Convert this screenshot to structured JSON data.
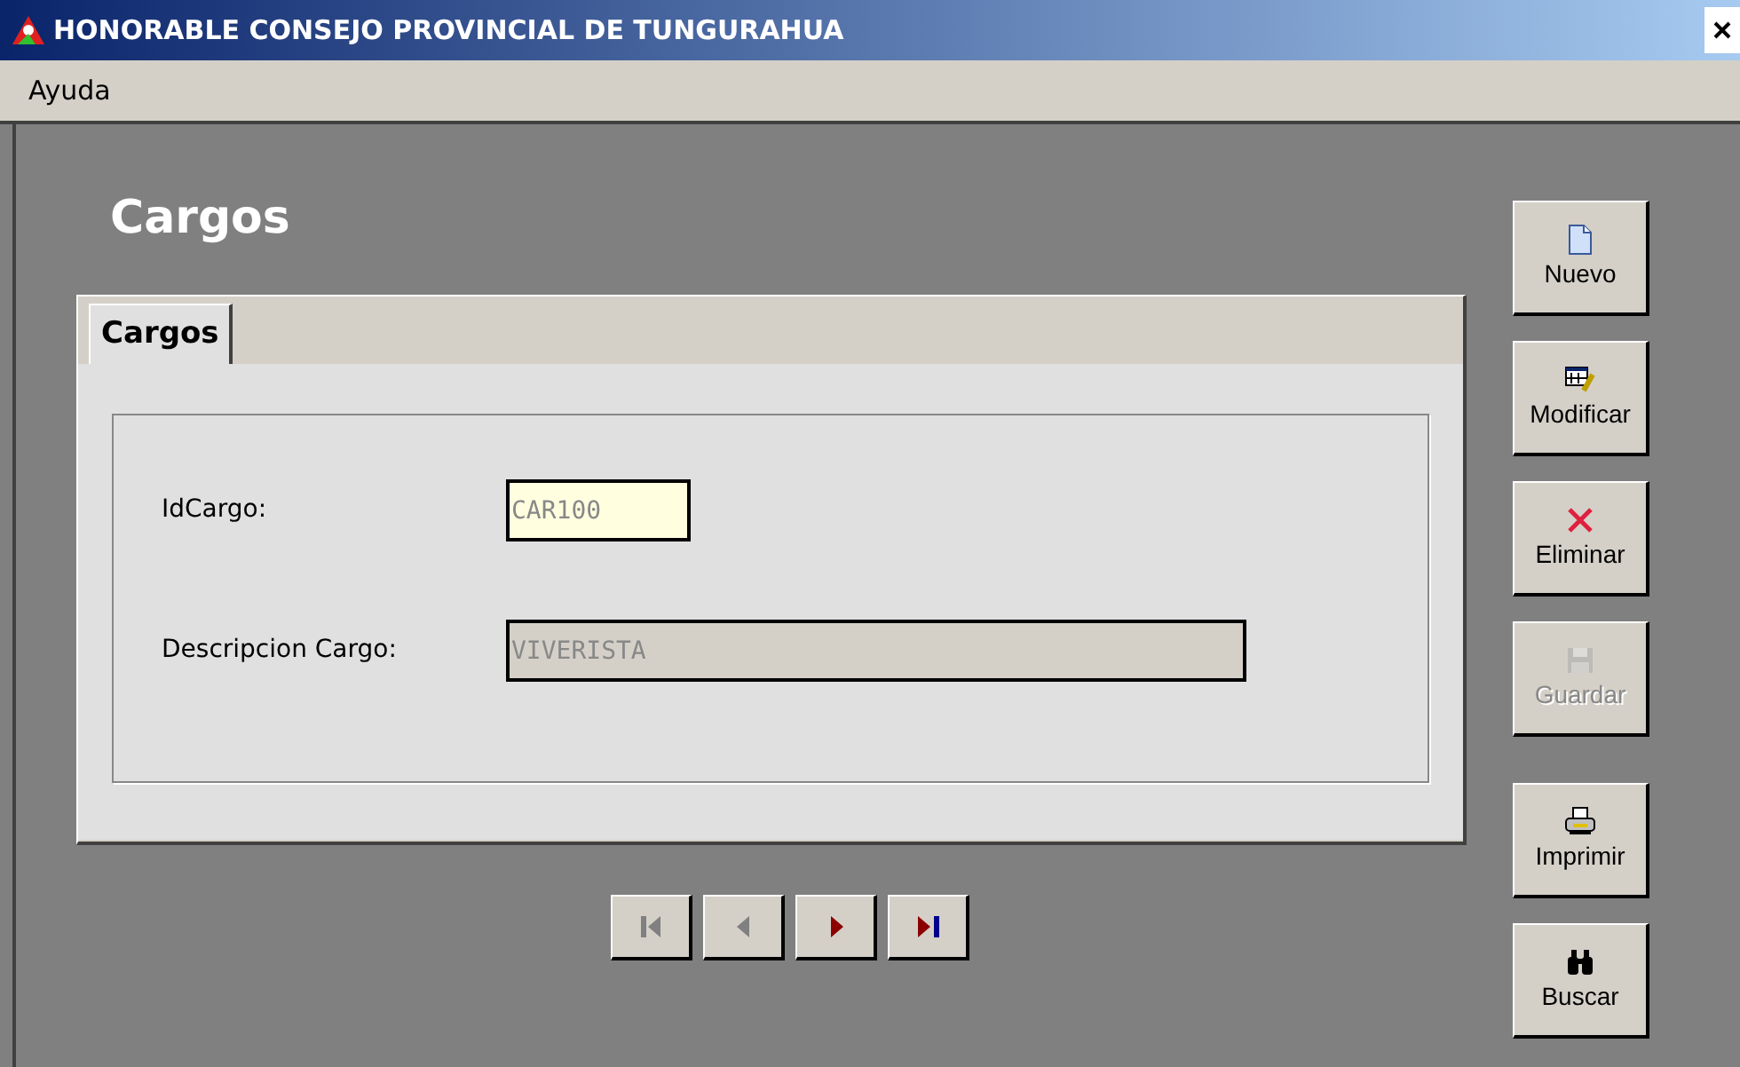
{
  "window": {
    "title": "HONORABLE CONSEJO PROVINCIAL DE TUNGURAHUA"
  },
  "menu": [
    "Ayuda"
  ],
  "heading": "Cargos",
  "tabs": [
    {
      "label": "Cargos",
      "selected": true
    }
  ],
  "fields": [
    {
      "label": "IdCargo:",
      "value": "CAR100",
      "kind": "key"
    },
    {
      "label": "Descripcion Cargo:",
      "value": "VIVERISTA",
      "kind": "text"
    }
  ],
  "navigation": [
    {
      "kind": "first",
      "disabled": true
    },
    {
      "kind": "previous",
      "disabled": true
    },
    {
      "kind": "next",
      "disabled": false
    },
    {
      "kind": "last",
      "disabled": false
    }
  ],
  "actions": [
    {
      "label": "Nuevo",
      "disabled": false
    },
    {
      "label": "Modificar",
      "disabled": false
    },
    {
      "label": "Eliminar",
      "disabled": false
    },
    {
      "label": "Guardar",
      "disabled": true
    },
    {
      "label": "Imprimir",
      "disabled": false
    },
    {
      "label": "Buscar",
      "disabled": false
    }
  ]
}
